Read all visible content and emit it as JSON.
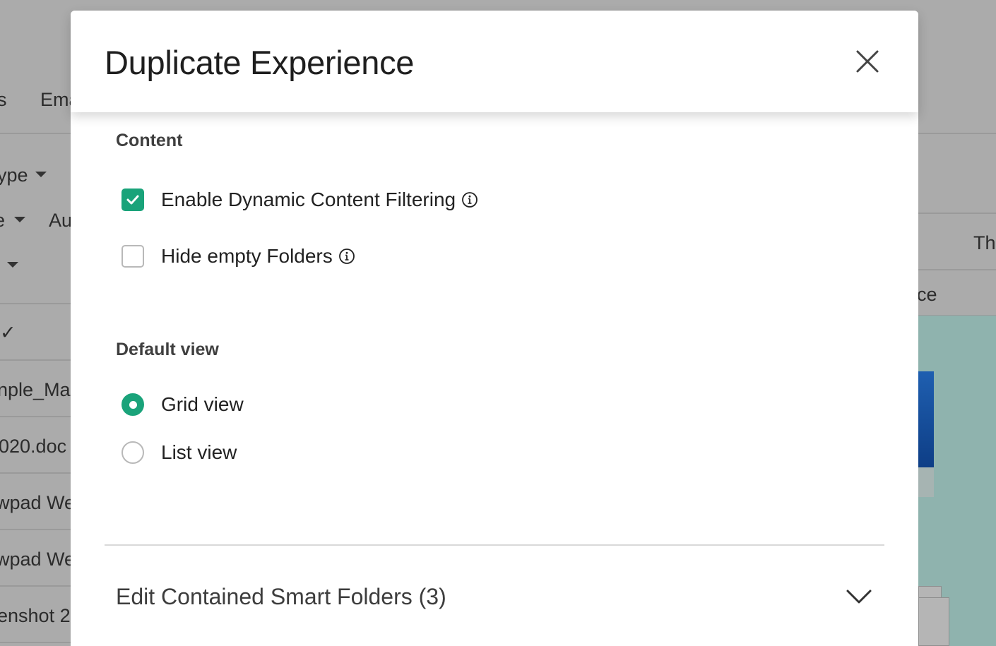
{
  "background": {
    "labels": [
      "s",
      "Ema",
      "ype",
      "e",
      "Au",
      "Th",
      "ce"
    ],
    "checkmark": "✓",
    "rows": [
      "nple_Mar",
      "020.doc",
      "wpad We",
      "wpad We",
      "enshot 2"
    ]
  },
  "modal": {
    "title": "Duplicate Experience",
    "content": {
      "section_label": "Content",
      "options": [
        {
          "label": "Enable Dynamic Content Filtering",
          "checked": true
        },
        {
          "label": "Hide empty Folders",
          "checked": false
        }
      ]
    },
    "default_view": {
      "section_label": "Default view",
      "options": [
        {
          "label": "Grid view",
          "selected": true
        },
        {
          "label": "List view",
          "selected": false
        }
      ]
    },
    "accordion": {
      "label": "Edit Contained Smart Folders (3)",
      "expanded": false
    }
  },
  "colors": {
    "accent": "#1aa37a",
    "overlay": "#ababab"
  }
}
